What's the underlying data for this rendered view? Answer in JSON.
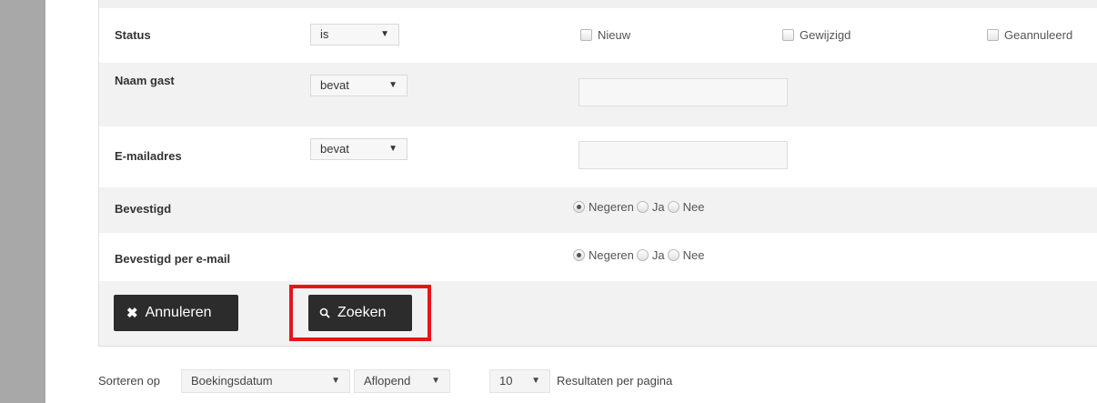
{
  "filters": {
    "status": {
      "label": "Status",
      "operator": "is",
      "options": [
        "Nieuw",
        "Gewijzigd",
        "Geannuleerd"
      ]
    },
    "naam_gast": {
      "label": "Naam gast",
      "operator": "bevat",
      "value": ""
    },
    "email": {
      "label": "E-mailadres",
      "operator": "bevat",
      "value": ""
    },
    "bevestigd": {
      "label": "Bevestigd",
      "options": [
        "Negeren",
        "Ja",
        "Nee"
      ],
      "selected": "Negeren"
    },
    "bevestigd_email": {
      "label": "Bevestigd per e-mail",
      "options": [
        "Negeren",
        "Ja",
        "Nee"
      ],
      "selected": "Negeren"
    }
  },
  "buttons": {
    "cancel": {
      "label": "Annuleren",
      "icon": "close-icon"
    },
    "search": {
      "label": "Zoeken",
      "icon": "search-icon"
    }
  },
  "sort": {
    "label": "Sorteren op",
    "field": "Boekingsdatum",
    "order": "Aflopend",
    "per_page": "10",
    "per_page_label": "Resultaten per pagina"
  },
  "colors": {
    "button_bg": "#2c2c2c",
    "highlight": "#e8141b",
    "sidebar": "#a8a8a8"
  }
}
